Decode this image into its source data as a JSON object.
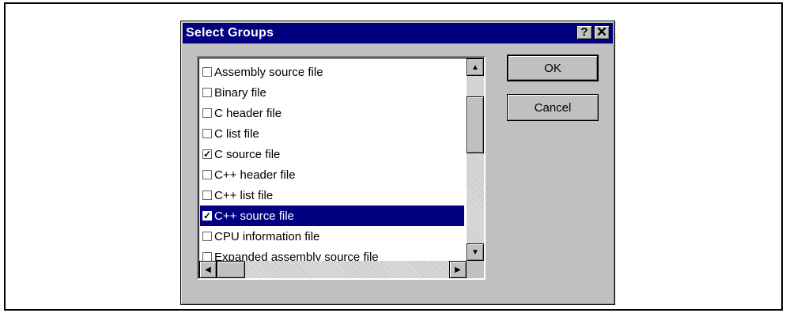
{
  "dialog": {
    "title": "Select Groups",
    "help_label": "?",
    "close_label": "✕",
    "ok_label": "OK",
    "cancel_label": "Cancel"
  },
  "list": {
    "items": [
      {
        "label": "Assembly source file",
        "checked": false,
        "selected": false
      },
      {
        "label": "Binary file",
        "checked": false,
        "selected": false
      },
      {
        "label": "C header file",
        "checked": false,
        "selected": false
      },
      {
        "label": "C list file",
        "checked": false,
        "selected": false
      },
      {
        "label": "C source file",
        "checked": true,
        "selected": false
      },
      {
        "label": "C++ header file",
        "checked": false,
        "selected": false
      },
      {
        "label": "C++ list file",
        "checked": false,
        "selected": false
      },
      {
        "label": "C++ source file",
        "checked": true,
        "selected": true
      },
      {
        "label": "CPU information file",
        "checked": false,
        "selected": false
      },
      {
        "label": "Expanded assembly source file",
        "checked": false,
        "selected": false
      }
    ],
    "check_mark": "✓"
  },
  "scroll": {
    "up_arrow": "▲",
    "down_arrow": "▼",
    "left_arrow": "◀",
    "right_arrow": "▶"
  }
}
